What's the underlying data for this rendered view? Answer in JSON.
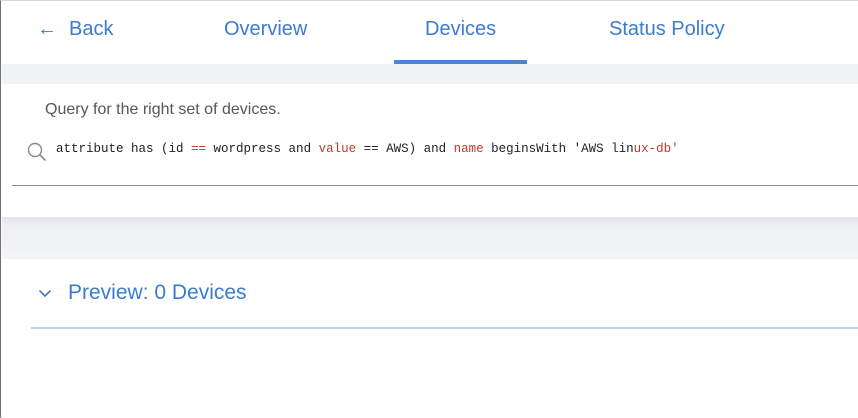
{
  "nav": {
    "back_label": "Back",
    "tabs": [
      {
        "label": "Overview"
      },
      {
        "label": "Devices"
      },
      {
        "label": "Status Policy"
      }
    ],
    "active_tab": "Devices"
  },
  "query": {
    "hint": "Query for the right set of devices.",
    "tokens": {
      "t1": "attribute has (id ",
      "t2": "==",
      "t3": " wordpress and ",
      "t4": "value",
      "t5": " == AWS) and ",
      "t6": "name",
      "t7": " beginsWith 'AWS lin",
      "t8": "ux-db'"
    }
  },
  "preview": {
    "label": "Preview: 0 Devices"
  },
  "colors": {
    "accent": "#3b7ccf",
    "keyword": "#c0392b",
    "band": "#f1f2f4"
  },
  "icons": {
    "back": "left-arrow-icon",
    "search": "search-icon",
    "expand": "chevron-down-icon"
  }
}
